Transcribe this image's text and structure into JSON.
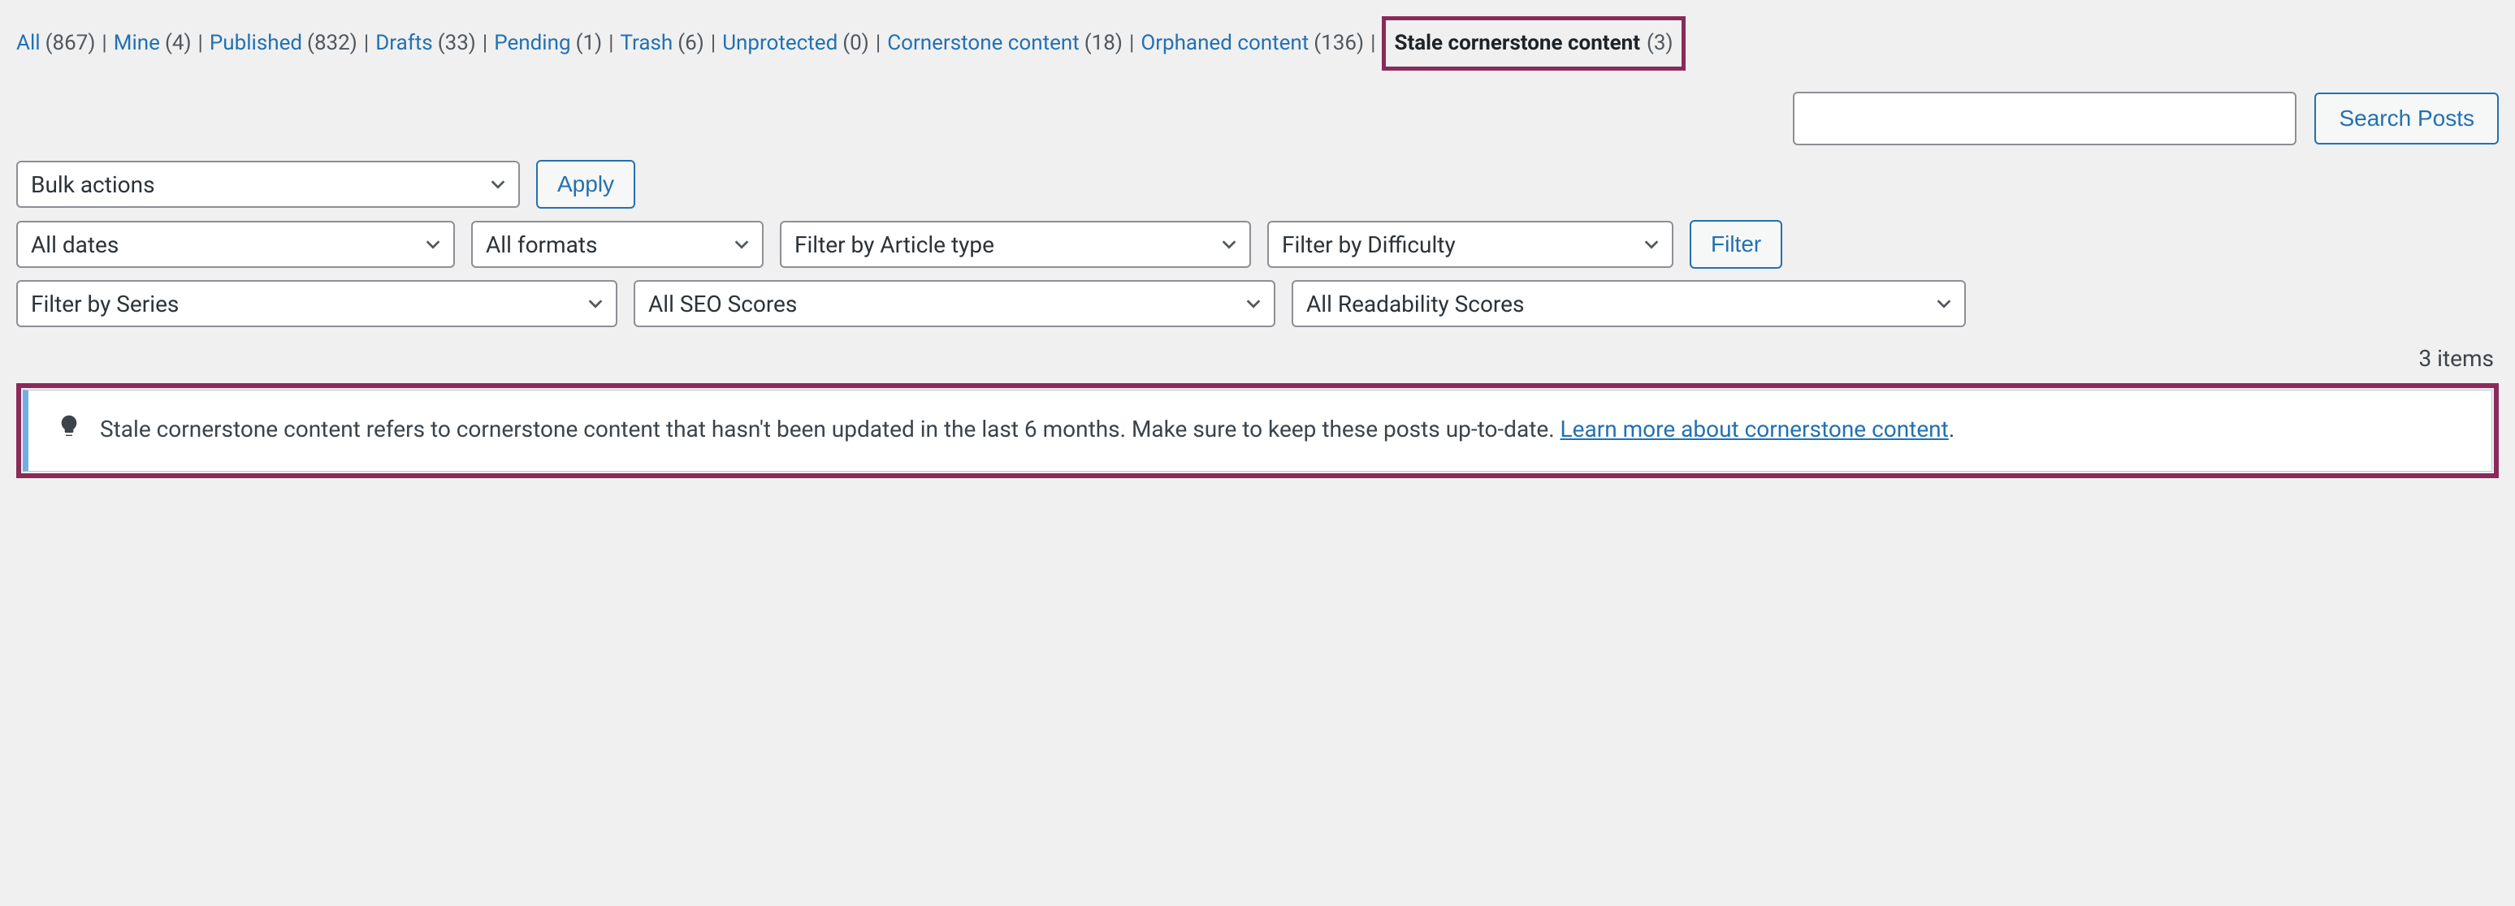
{
  "filters": [
    {
      "label": "All",
      "count": "(867)",
      "current": false
    },
    {
      "label": "Mine",
      "count": "(4)",
      "current": false
    },
    {
      "label": "Published",
      "count": "(832)",
      "current": false
    },
    {
      "label": "Drafts",
      "count": "(33)",
      "current": false
    },
    {
      "label": "Pending",
      "count": "(1)",
      "current": false
    },
    {
      "label": "Trash",
      "count": "(6)",
      "current": false
    },
    {
      "label": "Unprotected",
      "count": "(0)",
      "current": false
    },
    {
      "label": "Cornerstone content",
      "count": "(18)",
      "current": false
    },
    {
      "label": "Orphaned content",
      "count": "(136)",
      "current": false
    },
    {
      "label": "Stale cornerstone content",
      "count": "(3)",
      "current": true
    }
  ],
  "separator": "|",
  "search": {
    "placeholder": "",
    "button": "Search Posts"
  },
  "bulk": {
    "select": "Bulk actions",
    "apply": "Apply"
  },
  "filterRow1": {
    "dates": "All dates",
    "formats": "All formats",
    "article": "Filter by Article type",
    "difficulty": "Filter by Difficulty",
    "filterBtn": "Filter"
  },
  "filterRow2": {
    "series": "Filter by Series",
    "seo": "All SEO Scores",
    "readability": "All Readability Scores"
  },
  "itemsCount": "3 items",
  "notice": {
    "text": "Stale cornerstone content refers to cornerstone content that hasn't been updated in the last 6 months. Make sure to keep these posts up-to-date. ",
    "linkText": "Learn more about cornerstone content",
    "suffix": "."
  }
}
